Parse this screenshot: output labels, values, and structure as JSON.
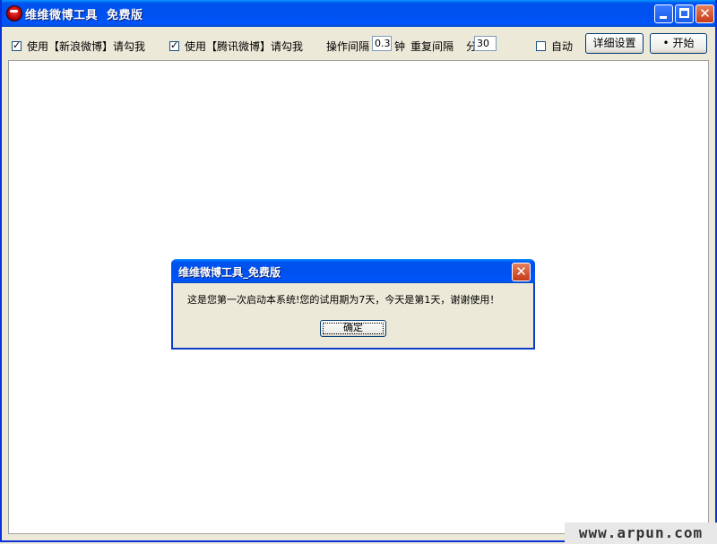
{
  "window": {
    "title": "维维微博工具  免费版",
    "min_label": "minimize",
    "max_label": "maximize"
  },
  "toolbar": {
    "sina_checkbox": {
      "checked": true,
      "label": "使用【新浪微博】请勾我"
    },
    "tencent_checkbox": {
      "checked": true,
      "label": "使用【腾讯微博】请勾我"
    },
    "interval_label": "操作间隔",
    "interval_value": "0.3",
    "interval_unit": "钟",
    "repeat_label": "重复间隔",
    "repeat_unit": "分",
    "repeat_value": "30",
    "auto_checkbox": {
      "checked": false,
      "label": "自动"
    },
    "settings_button": "详细设置",
    "start_button": "• 开始"
  },
  "dialog": {
    "title": "维维微博工具_免费版",
    "message": "这是您第一次启动本系统!您的试用期为7天，今天是第1天，谢谢使用！",
    "ok_button": "确定"
  },
  "watermark": "www.arpun.com"
}
